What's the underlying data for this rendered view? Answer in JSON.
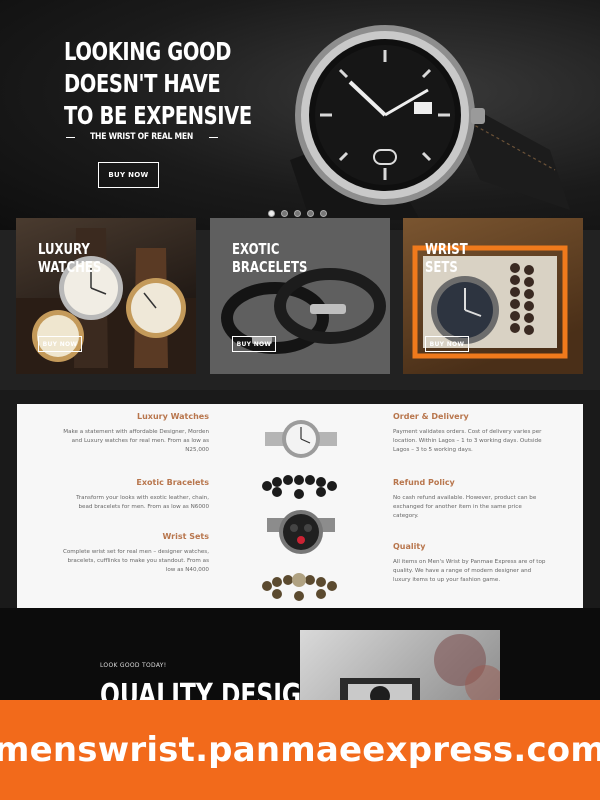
{
  "hero": {
    "headline": [
      "LOOKING GOOD",
      "DOESN'T HAVE",
      "TO BE EXPENSIVE"
    ],
    "subtitle": "THE WRIST OF REAL MEN",
    "cta": "BUY NOW",
    "slide_count": 5,
    "active_slide": 1
  },
  "categories": [
    {
      "title_lines": [
        "LUXURY",
        "WATCHES"
      ],
      "cta": "BUY NOW"
    },
    {
      "title_lines": [
        "EXOTIC",
        "BRACELETS"
      ],
      "cta": "BUY NOW"
    },
    {
      "title_lines": [
        "WRIST",
        "SETS"
      ],
      "cta": "BUY NOW"
    }
  ],
  "info_left": [
    {
      "title": "Luxury Watches",
      "text": "Make a statement with affordable Designer, Morden and Luxury watches for real men. From as low as N25,000"
    },
    {
      "title": "Exotic Bracelets",
      "text": "Transform your looks with exotic leather, chain, bead bracelets for men. From as low as N6000"
    },
    {
      "title": "Wrist Sets",
      "text": "Complete wrist set for real men – designer watches, bracelets, cufflinks to make you standout. From as low as N40,000"
    }
  ],
  "info_right": [
    {
      "title": "Order & Delivery",
      "text": "Payment validates orders. Cost of delivery varies per location. Within Lagos – 1 to 3 working days. Outside Lagos – 3 to 5 working days."
    },
    {
      "title": "Refund Policy",
      "text": "No cash refund available. However, product can be exchanged for another item in the same price category."
    },
    {
      "title": "Quality",
      "text": "All items on Men's Wrist by Panmae Express are of top quality. We have a range of modern designer and luxury items to up your fashion game."
    }
  ],
  "band": {
    "kicker": "LOOK GOOD TODAY!",
    "heading": "QUALITY DESIGNS"
  },
  "banner": {
    "domain": "menswrist.panmaeexpress.com"
  },
  "colors": {
    "accent_orange": "#f26a1b",
    "heading_brown": "#b8764d"
  }
}
